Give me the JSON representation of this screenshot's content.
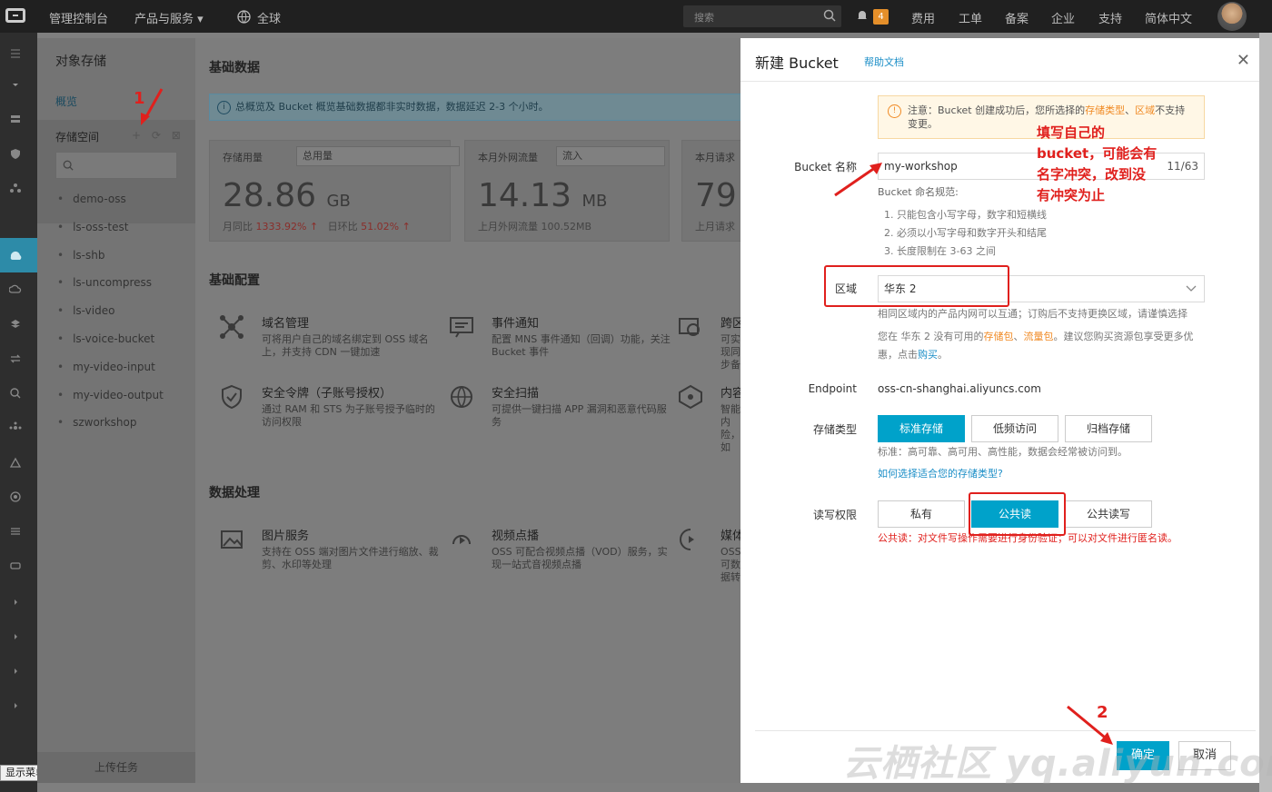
{
  "topbar": {
    "console": "管理控制台",
    "products": "产品与服务 ▾",
    "region": "全球",
    "search_placeholder": "搜索",
    "badge": "4",
    "links": [
      "费用",
      "工单",
      "备案",
      "企业",
      "支持",
      "简体中文"
    ]
  },
  "leftbar": {
    "show_menu": "显示菜单"
  },
  "sidepanel": {
    "title": "对象存储",
    "overview": "概览",
    "storage_space": "存储空间",
    "tools": "+ ⟳ ⊠",
    "buckets": [
      "demo-oss",
      "ls-oss-test",
      "ls-shb",
      "ls-uncompress",
      "ls-video",
      "ls-voice-bucket",
      "my-video-input",
      "my-video-output",
      "szworkshop"
    ],
    "upload": "上传任务"
  },
  "main": {
    "basic_data": "基础数据",
    "info": "总概览及 Bucket 概览基础数据都非实时数据，数据延迟 2-3 个小时。",
    "stats": [
      {
        "label": "存储用量",
        "select": "总用量",
        "value": "28.86",
        "unit": "GB",
        "sub_prefix": "月同比",
        "sub_a": "1333.92% ↑",
        "sub_mid": "日环比",
        "sub_b": "51.02% ↑"
      },
      {
        "label": "本月外网流量",
        "select": "流入",
        "value": "14.13",
        "unit": "MB",
        "sub": "上月外网流量  100.52MB"
      },
      {
        "label": "本月请求",
        "value": "79",
        "sub": "上月请求"
      }
    ],
    "basic_config": "基础配置",
    "features": [
      {
        "name": "域名管理",
        "desc": "可将用户自己的域名绑定到 OSS 域名上，并支持 CDN 一键加速"
      },
      {
        "name": "事件通知",
        "desc": "配置 MNS 事件通知（回调）功能，关注 Bucket 事件"
      },
      {
        "name": "跨区",
        "desc": "可实现同步备"
      },
      {
        "name": "安全令牌（子账号授权）",
        "desc": "通过 RAM 和 STS 为子账号授予临时的访问权限"
      },
      {
        "name": "安全扫描",
        "desc": "可提供一键扫描 APP 漏洞和恶意代码服务"
      },
      {
        "name": "内容安",
        "desc": "智能内险，如"
      }
    ],
    "data_processing": "数据处理",
    "features2": [
      {
        "name": "图片服务",
        "desc": "支持在 OSS 端对图片文件进行缩放、裁剪、水印等处理"
      },
      {
        "name": "视频点播",
        "desc": "OSS 可配合视频点播（VOD）服务，实现一站式音视频点播"
      },
      {
        "name": "媒体转",
        "desc": "OSS 可数据转"
      }
    ]
  },
  "modal": {
    "title": "新建 Bucket",
    "help": "帮助文档",
    "close": "✕",
    "notice_prefix": "注意：Bucket 创建成功后，您所选择的",
    "notice_type": "存储类型",
    "notice_sep": "、",
    "notice_region": "区域",
    "notice_suffix": "不支持变更。",
    "name_label": "Bucket 名称",
    "name_value": "my-workshop",
    "name_count": "11/63",
    "rules_title": "Bucket 命名规范:",
    "rules": [
      "1. 只能包含小写字母，数字和短横线",
      "2. 必须以小写字母和数字开头和结尾",
      "3. 长度限制在 3-63 之间"
    ],
    "region_label": "区域",
    "region_value": "华东 2",
    "region_hint": "相同区域内的产品内网可以互通；订购后不支持更换区域，请谨慎选择",
    "region_tip_a": "您在 华东 2 没有可用的",
    "region_tip_b": "存储包",
    "region_tip_c": "、",
    "region_tip_d": "流量包",
    "region_tip_e": "。建议您购买资源包享受更多优惠，点击",
    "region_tip_f": "购买",
    "region_tip_g": "。",
    "endpoint_label": "Endpoint",
    "endpoint_value": "oss-cn-shanghai.aliyuncs.com",
    "storage_label": "存储类型",
    "storage_options": [
      "标准存储",
      "低频访问",
      "归档存储"
    ],
    "storage_hint": "标准：高可靠、高可用、高性能，数据会经常被访问到。",
    "storage_link": "如何选择适合您的存储类型?",
    "acl_label": "读写权限",
    "acl_options": [
      "私有",
      "公共读",
      "公共读写"
    ],
    "acl_hint": "公共读：对文件写操作需要进行身份验证；可以对文件进行匿名读。",
    "ok": "确定",
    "cancel": "取消"
  },
  "annotations": {
    "one": "1",
    "two": "2",
    "note_lines": [
      "填写自己的",
      "bucket，可能会有",
      "名字冲突，改到没",
      "有冲突为止"
    ]
  },
  "watermark": "云栖社区 yq.aliyun.com",
  "colors": {
    "accent": "#00a2ca",
    "annotation": "#e0201d",
    "warning": "#f08a24",
    "link": "#1b8ec7"
  }
}
